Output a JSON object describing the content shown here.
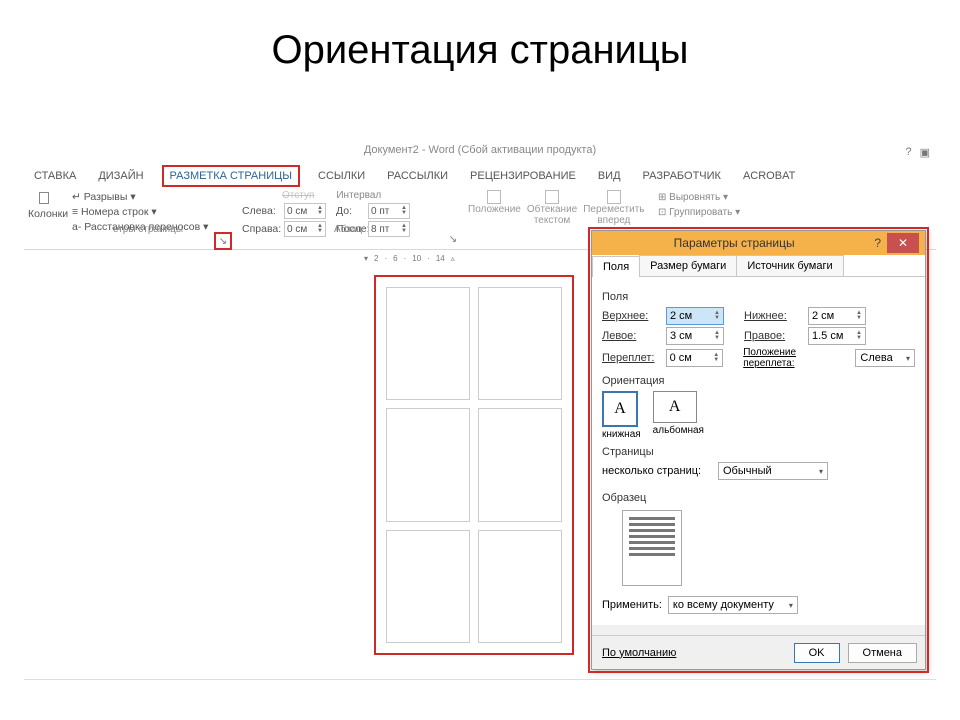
{
  "slide_title": "Ориентация страницы",
  "app_title": "Документ2 - Word (Сбой активации продукта)",
  "tabs": [
    "СТАВКА",
    "ДИЗАЙН",
    "РАЗМЕТКА СТРАНИЦЫ",
    "ССЫЛКИ",
    "РАССЫЛКИ",
    "РЕЦЕНЗИРОВАНИЕ",
    "ВИД",
    "РАЗРАБОТЧИК",
    "ACROBAT"
  ],
  "active_tab_index": 2,
  "ribbon": {
    "columns_label": "Колонки",
    "breaks": "Разрывы ▾",
    "line_numbers": "Номера строк ▾",
    "hyphenation": "Расстановка переносов ▾",
    "group1_label": "етры страницы",
    "indent_label": "Отступ",
    "spacing_label": "Интервал",
    "left_label": "Слева:",
    "right_label": "Справа:",
    "before_label": "До:",
    "after_label": "После:",
    "left_val": "0 см",
    "right_val": "0 см",
    "before_val": "0 пт",
    "after_val": "8 пт",
    "group2_label": "Абзац",
    "position": "Положение",
    "wrap": "Обтекание текстом",
    "forward": "Переместить вперед",
    "align": "Выровнять ▾",
    "group": "Группировать ▾"
  },
  "dialog": {
    "title": "Параметры страницы",
    "tabs": [
      "Поля",
      "Размер бумаги",
      "Источник бумаги"
    ],
    "active_tab": 0,
    "margins_label": "Поля",
    "top_label": "Верхнее:",
    "top_val": "2 см",
    "bottom_label": "Нижнее:",
    "bottom_val": "2 см",
    "left_label": "Левое:",
    "left_val": "3 см",
    "right_label": "Правое:",
    "right_val": "1.5 см",
    "gutter_label": "Переплет:",
    "gutter_val": "0 см",
    "gutter_pos_label": "Положение переплета:",
    "gutter_pos_val": "Слева",
    "orient_label": "Ориентация",
    "orient_portrait": "книжная",
    "orient_landscape": "альбомная",
    "pages_label": "Страницы",
    "multi_pages_label": "несколько страниц:",
    "multi_pages_val": "Обычный",
    "preview_label": "Образец",
    "apply_label": "Применить:",
    "apply_val": "ко всему документу",
    "default_btn": "По умолчанию",
    "ok_btn": "OK",
    "cancel_btn": "Отмена"
  }
}
